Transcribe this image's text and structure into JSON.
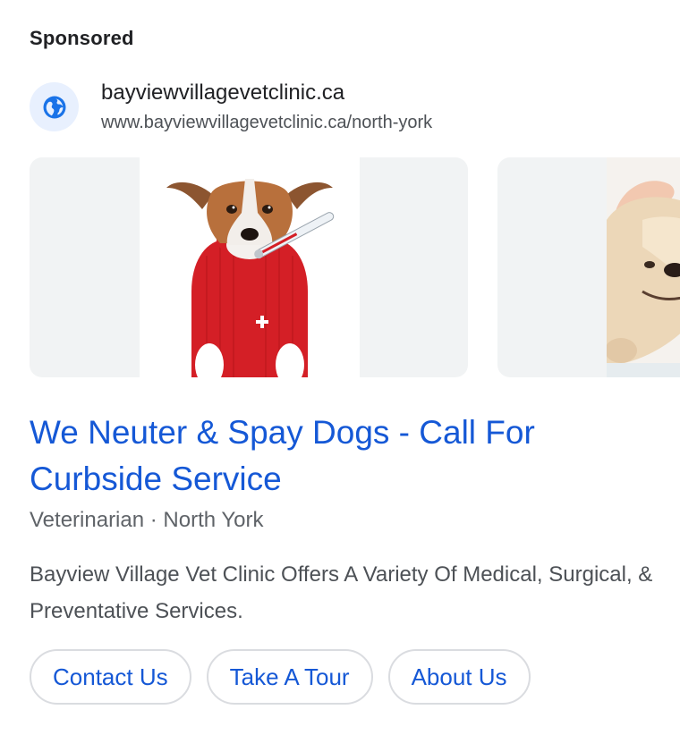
{
  "ad": {
    "sponsored_label": "Sponsored",
    "site_name": "bayviewvillagevetclinic.ca",
    "site_url": "www.bayviewvillagevetclinic.ca/north-york",
    "favicon_icon": "globe-icon",
    "images": [
      {
        "subject": "dog-in-red-sweater-with-thermometer"
      },
      {
        "subject": "golden-retriever-being-petted"
      }
    ],
    "title": "We Neuter & Spay Dogs - Call For Curbside Service",
    "meta": "Veterinarian · North York",
    "description": "Bayview Village Vet Clinic Offers A Variety Of Medical, Surgical, & Preventative Services.",
    "buttons": [
      {
        "label": "Contact Us"
      },
      {
        "label": "Take A Tour"
      },
      {
        "label": "About Us"
      }
    ]
  },
  "colors": {
    "link_blue": "#1558d6",
    "favicon_bg": "#e8f0fe",
    "favicon_fg": "#1a73e8",
    "card_bg": "#f1f3f4",
    "sweater_red": "#d41f26"
  }
}
